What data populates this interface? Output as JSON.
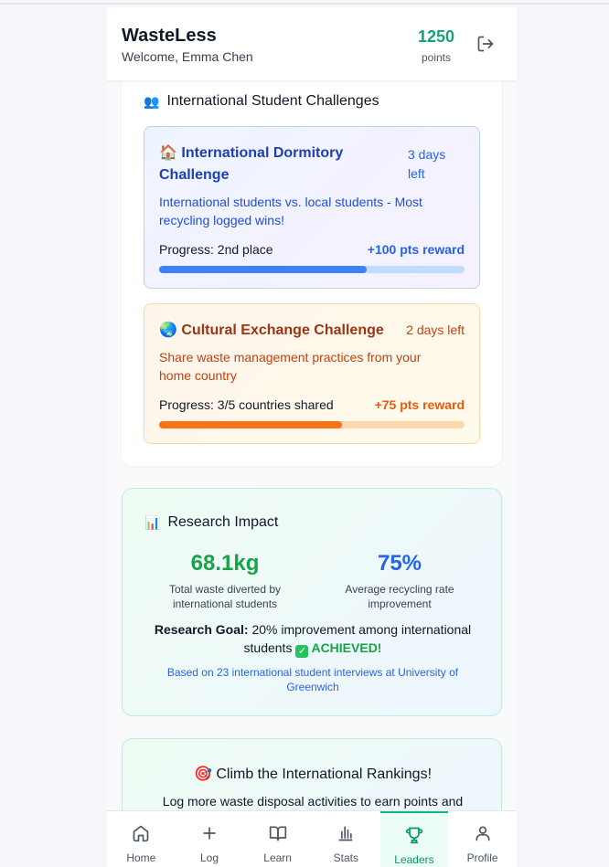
{
  "header": {
    "app_name": "WasteLess",
    "welcome": "Welcome, Emma Chen",
    "points_value": "1250",
    "points_label": "points"
  },
  "colors": {
    "brand_green": "#16a37a",
    "intl_blue": "#2563eb",
    "culture_orange": "#ea580c",
    "success_green": "#16a34a"
  },
  "challenges_section": {
    "icon": "people-emoji",
    "emoji": "👥",
    "title": "International Student Challenges",
    "items": [
      {
        "icon": "house-emoji",
        "emoji": "🏠",
        "title": "International Dormitory Challenge",
        "time_left": "3 days left",
        "description": "International students vs. local students - Most recycling logged wins!",
        "progress": "Progress: 2nd place",
        "reward": "+100 pts reward",
        "progress_fraction": 0.68
      },
      {
        "icon": "globe-emoji",
        "emoji": "🌏",
        "title": "Cultural Exchange Challenge",
        "time_left": "2 days left",
        "description": "Share waste management practices from your home country",
        "progress": "Progress: 3/5 countries shared",
        "reward": "+75 pts reward",
        "progress_fraction": 0.6
      }
    ]
  },
  "research_impact": {
    "icon": "bar-chart-emoji",
    "emoji": "📊",
    "title": "Research Impact",
    "stats": [
      {
        "value": "68.1kg",
        "label": "Total waste diverted by international students"
      },
      {
        "value": "75%",
        "label": "Average recycling rate improvement"
      }
    ],
    "goal_label": "Research Goal:",
    "goal_text": "20% improvement among international students",
    "goal_status": "ACHIEVED!",
    "source": "Based on 23 international student interviews at University of Greenwich"
  },
  "climb": {
    "icon": "target-emoji",
    "emoji": "🎯",
    "title": "Climb the International Rankings!",
    "description": "Log more waste disposal activities to earn points and"
  },
  "nav": {
    "items": [
      {
        "label": "Home",
        "icon": "home-icon"
      },
      {
        "label": "Log",
        "icon": "plus-icon"
      },
      {
        "label": "Learn",
        "icon": "book-icon"
      },
      {
        "label": "Stats",
        "icon": "bar-chart-icon"
      },
      {
        "label": "Leaders",
        "icon": "trophy-icon",
        "active": true
      },
      {
        "label": "Profile",
        "icon": "user-icon"
      }
    ]
  }
}
